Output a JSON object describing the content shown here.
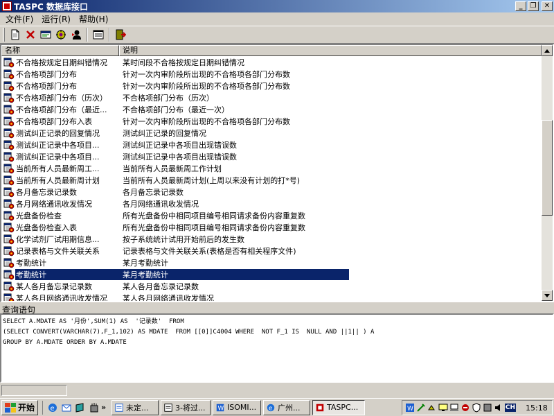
{
  "window": {
    "title": "TASPC 数据库接口",
    "controls": {
      "minimize": "_",
      "maximize": "❐",
      "close": "✕"
    }
  },
  "menu": [
    "文件(F)",
    "运行(R)",
    "帮助(H)"
  ],
  "toolbar_icons": [
    "new-icon",
    "delete-icon",
    "edit-icon",
    "run-icon",
    "user-icon",
    "window-icon",
    "exit-icon"
  ],
  "list": {
    "columns": [
      "名称",
      "说明"
    ],
    "selected_index": 18,
    "rows": [
      {
        "name": "不合格按规定日期纠错情况",
        "desc": "某时间段不合格按规定日期纠错情况"
      },
      {
        "name": "不合格项部门分布",
        "desc": "针对一次内审阶段所出现的不合格项各部门分布数"
      },
      {
        "name": "不合格项部门分布",
        "desc": "针对一次内审阶段所出现的不合格项各部门分布数"
      },
      {
        "name": "不合格项部门分布（历次）",
        "desc": "不合格项部门分布（历次）"
      },
      {
        "name": "不合格项部门分布（最近...",
        "desc": "不合格项部门分布（最近一次）"
      },
      {
        "name": "不合格项部门分布入表",
        "desc": "针对一次内审阶段所出现的不合格项各部门分布数"
      },
      {
        "name": "测试纠正记录的回复情况",
        "desc": "测试纠正记录的回复情况"
      },
      {
        "name": "测试纠正记录中各项目...",
        "desc": "测试纠正记录中各项目出现错误数"
      },
      {
        "name": "测试纠正记录中各项目...",
        "desc": "测试纠正记录中各项目出现错误数"
      },
      {
        "name": "当前所有人员最新周工...",
        "desc": "当前所有人员最新周工作计划"
      },
      {
        "name": "当前所有人员最新周计划",
        "desc": "当前所有人员最新周计划(上周以来没有计划的打*号)"
      },
      {
        "name": "各月备忘录记录数",
        "desc": "各月备忘录记录数"
      },
      {
        "name": "各月网络通讯收发情况",
        "desc": "各月网络通讯收发情况"
      },
      {
        "name": "光盘备份检查",
        "desc": "所有光盘备份中相同项目编号相同请求备份内容重复数"
      },
      {
        "name": "光盘备份检查入表",
        "desc": "所有光盘备份中相同项目编号相同请求备份内容重复数"
      },
      {
        "name": "化学试剂厂试用期信息...",
        "desc": "按子系统统计试用开始前后的发生数"
      },
      {
        "name": "记录表格与文件关联关系",
        "desc": "记录表格与文件关联关系(表格是否有相关程序文件)"
      },
      {
        "name": "考勤统计",
        "desc": "某月考勤统计"
      },
      {
        "name": "考勤统计",
        "desc": "某月考勤统计"
      },
      {
        "name": "某人各月备忘录记录数",
        "desc": "某人各月备忘录记录数"
      },
      {
        "name": "某人各月网络通讯收发情况",
        "desc": "某人各月网络通讯收发情况"
      }
    ]
  },
  "query": {
    "label": "查询语句",
    "text": "SELECT A.MDATE AS '月份',SUM(1) AS  '记录数'  FROM\n(SELECT CONVERT(VARCHAR(7),F_1,102) AS MDATE  FROM [[0]]C4004 WHERE  NOT F_1 IS  NULL AND ||1|| ) A\nGROUP BY A.MDATE ORDER BY A.MDATE"
  },
  "taskbar": {
    "start_label": "开始",
    "chevron": "»",
    "tasks": [
      {
        "label": "未定...",
        "active": false
      },
      {
        "label": "3-将过...",
        "active": false
      },
      {
        "label": "ISOMI...",
        "active": false
      },
      {
        "label": "广州...",
        "active": false
      },
      {
        "label": "TASPC...",
        "active": true
      }
    ],
    "tray_lang": "CH",
    "clock": "15:18"
  }
}
